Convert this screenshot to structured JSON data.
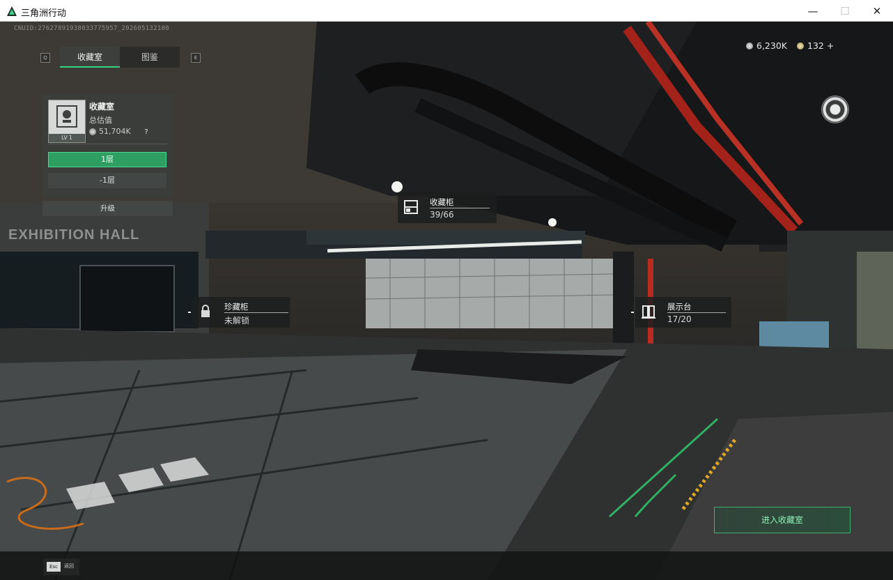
{
  "window": {
    "title": "三角洲行动",
    "min_glyph": "—",
    "max_glyph": "☐",
    "close_glyph": "✕"
  },
  "hud": {
    "uid": "CNUID:27627891938033775957_202605132100",
    "key_left": "Q",
    "key_right": "E",
    "tabs": [
      {
        "label": "收藏室",
        "active": true
      },
      {
        "label": "图鉴",
        "active": false
      }
    ],
    "currency": [
      {
        "icon": "silver-coin-icon",
        "value": "6,230K"
      },
      {
        "icon": "gold-coin-icon",
        "value": "132 +"
      }
    ]
  },
  "collection_card": {
    "title": "收藏室",
    "subtitle": "总估值",
    "level": "LV 1",
    "value": "51,704K",
    "help": "?",
    "floors": [
      {
        "label": "1层",
        "active": true
      },
      {
        "label": "-1层",
        "active": false
      }
    ],
    "upgrade_label": "升级"
  },
  "markers": {
    "cabinet": {
      "name": "收藏柜",
      "count": "39/66"
    },
    "treasure": {
      "name": "珍藏柜",
      "status": "未解锁"
    },
    "display": {
      "name": "展示台",
      "count": "17/20"
    }
  },
  "scene_text": {
    "hall_sign": "EXHIBITION HALL"
  },
  "actions": {
    "enter_label": "进入收藏室",
    "esc_key": "Esc",
    "esc_label": "返回"
  },
  "colors": {
    "accent_green": "#38d383",
    "active_floor": "#2e9e63",
    "pipe_red": "#b3241c"
  }
}
